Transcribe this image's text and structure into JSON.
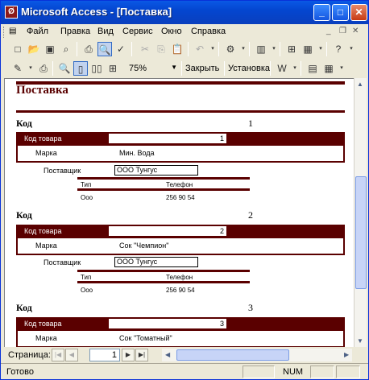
{
  "window": {
    "title": "Microsoft Access - [Поставка]",
    "app_icon": "access-key-icon"
  },
  "menu": [
    "Файл",
    "Правка",
    "Вид",
    "Сервис",
    "Окно",
    "Справка"
  ],
  "toolbar": {
    "zoom": "75%",
    "close_label": "Закрыть",
    "setup_label": "Установка"
  },
  "report": {
    "title": "Поставка",
    "groups": [
      {
        "kod_label": "Код",
        "kod": "1",
        "product_code_label": "Код товара",
        "product_code": "1",
        "brand_label": "Марка",
        "brand": "Мин. Вода",
        "supplier_label": "Поставщик",
        "supplier": "ООО Тунгус",
        "sub_headers": [
          "Тип",
          "Телефон"
        ],
        "sub_values": [
          "Ооо",
          "256 90 54"
        ]
      },
      {
        "kod_label": "Код",
        "kod": "2",
        "product_code_label": "Код товара",
        "product_code": "2",
        "brand_label": "Марка",
        "brand": "Сок \"Чемпион\"",
        "supplier_label": "Поставщик",
        "supplier": "ООО Тунгус",
        "sub_headers": [
          "Тип",
          "Телефон"
        ],
        "sub_values": [
          "Ооо",
          "256 90 54"
        ]
      },
      {
        "kod_label": "Код",
        "kod": "3",
        "product_code_label": "Код товара",
        "product_code": "3",
        "brand_label": "Марка",
        "brand": "Сок \"Томатный\""
      }
    ]
  },
  "navigation": {
    "page_label": "Страница:",
    "page": "1"
  },
  "status": {
    "ready": "Готово",
    "num": "NUM"
  },
  "colors": {
    "report_accent": "#5a0000",
    "titlebar": "#0a58e5"
  }
}
